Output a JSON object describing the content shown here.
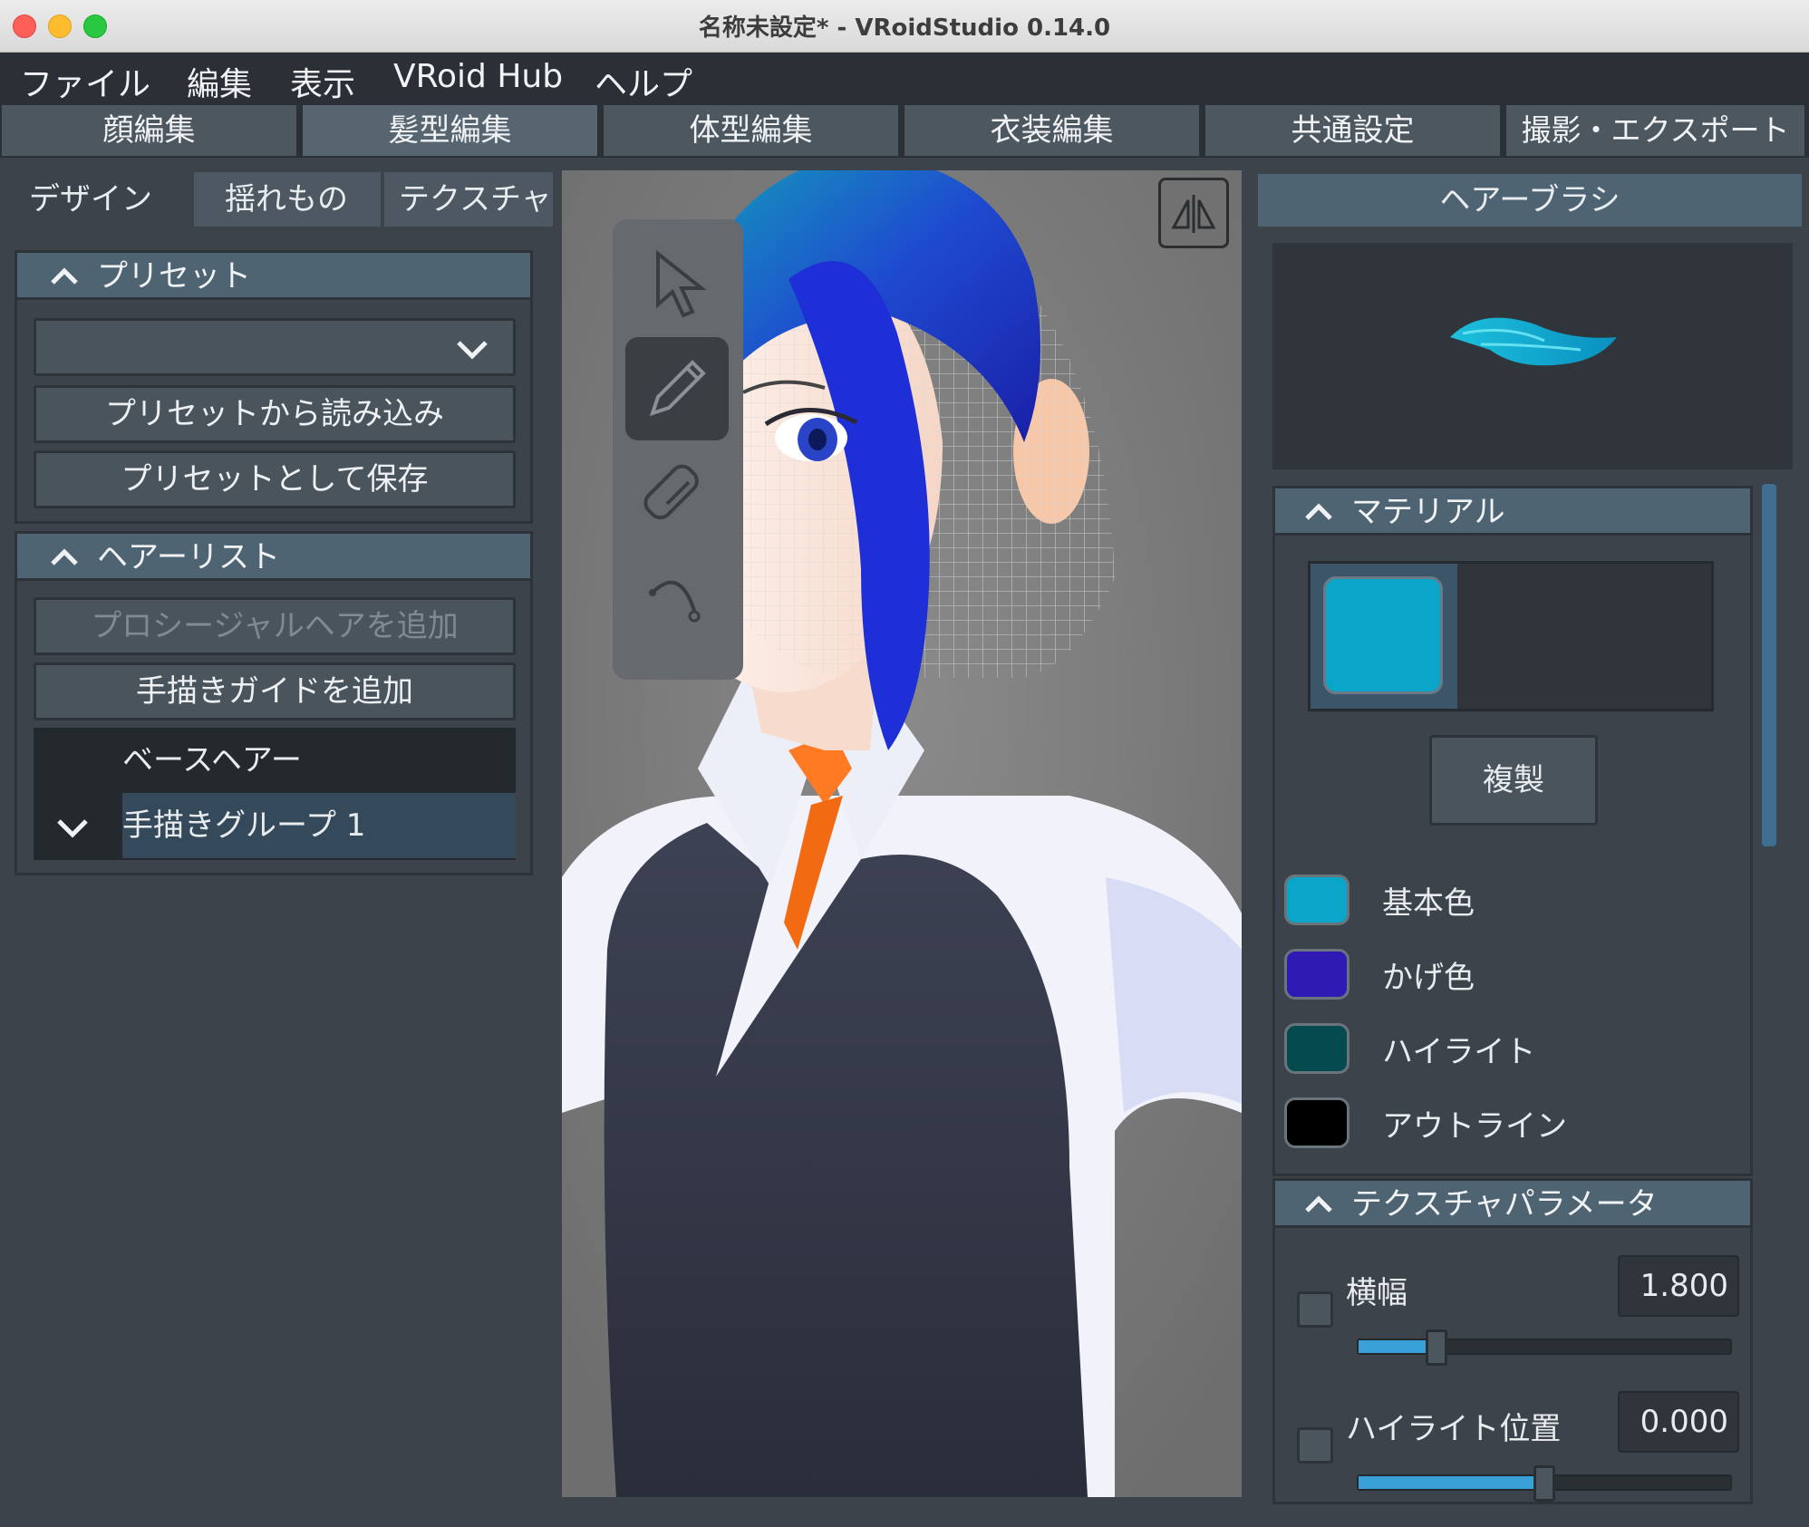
{
  "window": {
    "title": "名称未設定* - VRoidStudio 0.14.0"
  },
  "menu": [
    "ファイル",
    "編集",
    "表示",
    "VRoid Hub",
    "ヘルプ"
  ],
  "main_tabs": [
    "顔編集",
    "髪型編集",
    "体型編集",
    "衣装編集",
    "共通設定",
    "撮影・エクスポート"
  ],
  "active_main_tab": "髪型編集",
  "left": {
    "sub_tabs": [
      "デザイン",
      "揺れもの",
      "テクスチャ"
    ],
    "preset": {
      "header": "プリセット",
      "selected": "",
      "load_button": "プリセットから読み込み",
      "save_button": "プリセットとして保存"
    },
    "hairlist": {
      "header": "ヘアーリスト",
      "add_procedural": "プロシージャルヘアを追加",
      "add_guide": "手描きガイドを追加",
      "items": [
        "ベースヘアー",
        "手描きグループ 1"
      ],
      "selected_index": 1
    }
  },
  "viewport": {
    "tools": [
      "select-tool",
      "brush-tool",
      "eraser-tool",
      "guide-curve-tool"
    ],
    "active_tool": "brush-tool"
  },
  "right": {
    "header": "ヘアーブラシ",
    "material": {
      "header": "マテリアル",
      "swatch_color": "#0aa5c9",
      "duplicate_button": "複製",
      "colors": [
        {
          "label": "基本色",
          "color": "#0aa5c9"
        },
        {
          "label": "かげ色",
          "color": "#2f1ab3"
        },
        {
          "label": "ハイライト",
          "color": "#054a4e"
        },
        {
          "label": "アウトライン",
          "color": "#000000"
        }
      ]
    },
    "texture_params": {
      "header": "テクスチャパラメータ",
      "params": [
        {
          "label": "横幅",
          "value": "1.800",
          "fraction": 0.21
        },
        {
          "label": "ハイライト位置",
          "value": "0.000",
          "fraction": 0.5
        }
      ]
    }
  }
}
